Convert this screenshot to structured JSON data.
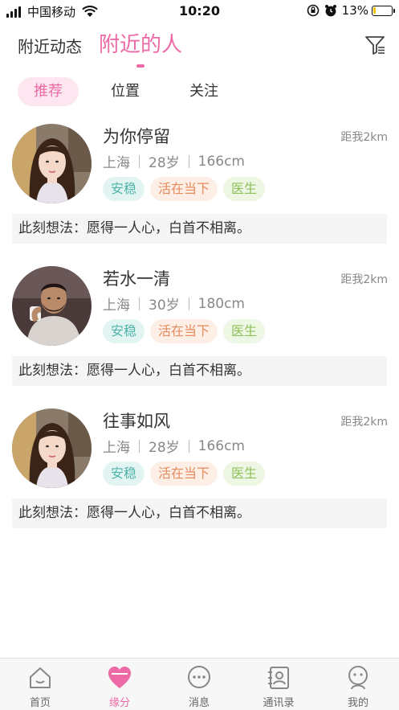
{
  "status_bar": {
    "carrier": "中国移动",
    "time": "10:20",
    "battery": "13%"
  },
  "header": {
    "tab_dynamic": "附近动态",
    "tab_people": "附近的人"
  },
  "subtabs": {
    "recommend": "推荐",
    "position": "位置",
    "follow": "关注"
  },
  "cards": [
    {
      "name": "为你停留",
      "distance": "距我2km",
      "city": "上海",
      "age": "28岁",
      "height": "166cm",
      "tags": [
        "安稳",
        "活在当下",
        "医生"
      ],
      "thought": "此刻想法：愿得一人心，白首不相离。"
    },
    {
      "name": "若水一清",
      "distance": "距我2km",
      "city": "上海",
      "age": "30岁",
      "height": "180cm",
      "tags": [
        "安稳",
        "活在当下",
        "医生"
      ],
      "thought": "此刻想法：愿得一人心，白首不相离。"
    },
    {
      "name": "往事如风",
      "distance": "距我2km",
      "city": "上海",
      "age": "28岁",
      "height": "166cm",
      "tags": [
        "安稳",
        "活在当下",
        "医生"
      ],
      "thought": "此刻想法：愿得一人心，白首不相离。"
    }
  ],
  "bottom_nav": [
    {
      "label": "首页",
      "icon": "home-icon"
    },
    {
      "label": "缘分",
      "icon": "heart-icon"
    },
    {
      "label": "消息",
      "icon": "message-icon"
    },
    {
      "label": "通讯录",
      "icon": "contacts-icon"
    },
    {
      "label": "我的",
      "icon": "profile-icon"
    }
  ],
  "colors": {
    "accent": "#ee6aa7",
    "accent_light": "#fde6ef"
  }
}
